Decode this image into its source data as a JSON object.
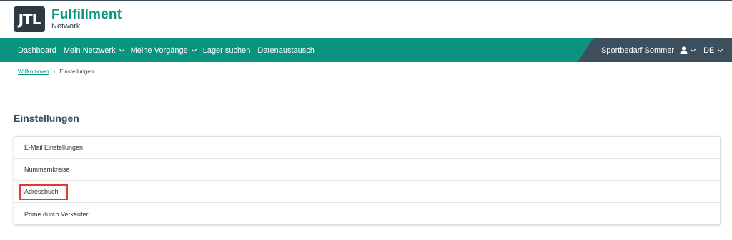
{
  "header": {
    "logo_mark": "JTL",
    "logo_title": "Fulfillment",
    "logo_subtitle": "Network"
  },
  "nav": {
    "items": [
      {
        "label": "Dashboard",
        "dropdown": false
      },
      {
        "label": "Mein Netzwerk",
        "dropdown": true
      },
      {
        "label": "Meine Vorgänge",
        "dropdown": true
      },
      {
        "label": "Lager suchen",
        "dropdown": false
      },
      {
        "label": "Datenaustausch",
        "dropdown": false
      }
    ],
    "user_name": "Sportbedarf Sommer",
    "language": "DE"
  },
  "breadcrumb": {
    "home": "Willkommen",
    "current": "Einstellungen"
  },
  "page": {
    "title": "Einstellungen"
  },
  "settings": {
    "items": [
      {
        "label": "E-Mail Einstellungen"
      },
      {
        "label": "Nummernkreise"
      },
      {
        "label": "Adressbuch",
        "highlighted": true
      },
      {
        "label": "Prime durch Verkäufer"
      }
    ]
  },
  "colors": {
    "brand": "#0a9480",
    "dark": "#3d4f5c",
    "highlight": "#e53935"
  }
}
